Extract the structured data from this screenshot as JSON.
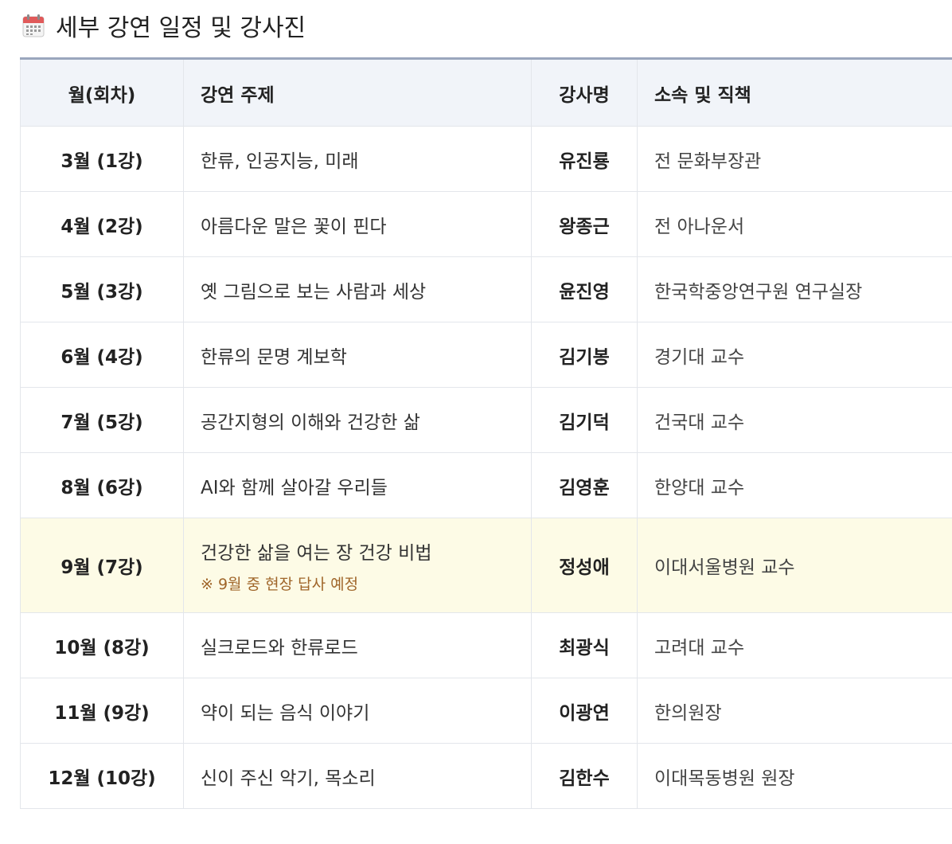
{
  "section": {
    "icon": "calendar-icon",
    "title": "세부 강연 일정 및 강사진"
  },
  "table": {
    "headers": {
      "month": "월(회차)",
      "topic": "강연 주제",
      "lecturer": "강사명",
      "affiliation": "소속 및 직책"
    },
    "rows": [
      {
        "month": "3월 (1강)",
        "topic": "한류, 인공지능, 미래",
        "note": "",
        "lecturer": "유진룡",
        "affiliation": "전 문화부장관"
      },
      {
        "month": "4월 (2강)",
        "topic": "아름다운 말은 꽃이 핀다",
        "note": "",
        "lecturer": "왕종근",
        "affiliation": "전 아나운서"
      },
      {
        "month": "5월 (3강)",
        "topic": "옛 그림으로 보는 사람과 세상",
        "note": "",
        "lecturer": "윤진영",
        "affiliation": "한국학중앙연구원 연구실장"
      },
      {
        "month": "6월 (4강)",
        "topic": "한류의 문명 계보학",
        "note": "",
        "lecturer": "김기봉",
        "affiliation": "경기대 교수"
      },
      {
        "month": "7월 (5강)",
        "topic": "공간지형의 이해와 건강한 삶",
        "note": "",
        "lecturer": "김기덕",
        "affiliation": "건국대 교수"
      },
      {
        "month": "8월 (6강)",
        "topic": "AI와 함께 살아갈 우리들",
        "note": "",
        "lecturer": "김영훈",
        "affiliation": "한양대 교수"
      },
      {
        "month": "9월 (7강)",
        "topic": "건강한 삶을 여는 장 건강 비법",
        "note": "※ 9월 중 현장 답사 예정",
        "lecturer": "정성애",
        "affiliation": "이대서울병원 교수"
      },
      {
        "month": "10월 (8강)",
        "topic": "실크로드와 한류로드",
        "note": "",
        "lecturer": "최광식",
        "affiliation": "고려대 교수"
      },
      {
        "month": "11월 (9강)",
        "topic": "약이 되는 음식 이야기",
        "note": "",
        "lecturer": "이광연",
        "affiliation": "한의원장"
      },
      {
        "month": "12월 (10강)",
        "topic": "신이 주신 악기, 목소리",
        "note": "",
        "lecturer": "김한수",
        "affiliation": "이대목동병원 원장"
      }
    ]
  },
  "colors": {
    "header_bg": "#f1f4f9",
    "header_top_border": "#9aa7bd",
    "highlight_bg": "#fdfbe6",
    "note_text": "#a0662a"
  }
}
